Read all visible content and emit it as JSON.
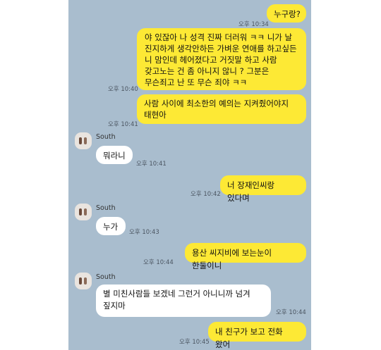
{
  "messages": [
    {
      "side": "me",
      "text": "누구랑?",
      "time": "오후 10:34"
    },
    {
      "side": "me",
      "text": "야 있잖아 나 성격 진짜 더러워 ㅋㅋ 니가 날 진지하게 생각안하든 가벼운 연애를 하고싶든 니 맘인데  헤어졌다고 거짓말 하고 사람 갖고노는 건 좀 아니지 않니 ? 그분은 무슨죄고 난 또 무슨 죄야 ㅋㅋ",
      "time": "오후 10:40"
    },
    {
      "side": "me",
      "text": "사람 사이에 최소한의 예의는 지켜줬어야지 태현아",
      "time": "오후 10:41"
    },
    {
      "side": "other",
      "sender": "South",
      "text": "뭐라니",
      "time": "오후 10:41"
    },
    {
      "side": "me",
      "text": "너 장재인씨랑 있다며",
      "time": "오후 10:42"
    },
    {
      "side": "other",
      "sender": "South",
      "text": "누가",
      "time": "오후 10:43"
    },
    {
      "side": "me",
      "text": "용산 씨지비에 보는눈이 한둘이니",
      "time": "오후 10:44"
    },
    {
      "side": "other",
      "sender": "South",
      "text": "별 미친사람들 보겠네 그런거 아니니까 넘겨 짚지마",
      "time": "오후 10:44"
    },
    {
      "side": "me",
      "text": "내 친구가 보고 전화 왔어",
      "time": "오후 10:45"
    }
  ],
  "colors": {
    "background": "#a9bdce",
    "me_bubble": "#fde935",
    "other_bubble": "#ffffff"
  },
  "icons": {
    "avatar": "profile-photo"
  }
}
